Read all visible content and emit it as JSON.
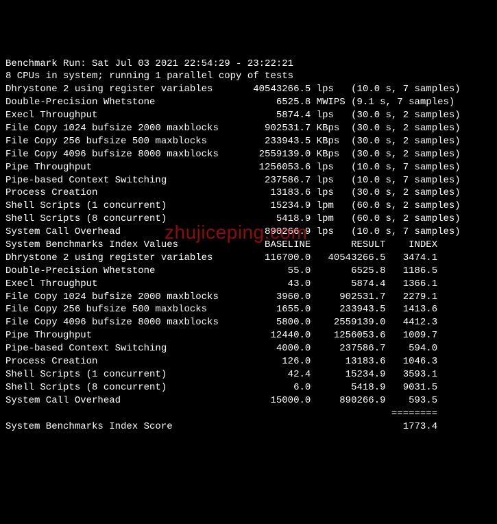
{
  "header": {
    "run_line": "Benchmark Run: Sat Jul 03 2021 22:54:29 - 23:22:21",
    "sys_line": "8 CPUs in system; running 1 parallel copy of tests"
  },
  "tests": [
    {
      "name": "Dhrystone 2 using register variables",
      "value": "40543266.5",
      "unit": "lps",
      "timing": "(10.0 s, 7 samples)"
    },
    {
      "name": "Double-Precision Whetstone",
      "value": "6525.8",
      "unit": "MWIPS",
      "timing": "(9.1 s, 7 samples)"
    },
    {
      "name": "Execl Throughput",
      "value": "5874.4",
      "unit": "lps",
      "timing": "(30.0 s, 2 samples)"
    },
    {
      "name": "File Copy 1024 bufsize 2000 maxblocks",
      "value": "902531.7",
      "unit": "KBps",
      "timing": "(30.0 s, 2 samples)"
    },
    {
      "name": "File Copy 256 bufsize 500 maxblocks",
      "value": "233943.5",
      "unit": "KBps",
      "timing": "(30.0 s, 2 samples)"
    },
    {
      "name": "File Copy 4096 bufsize 8000 maxblocks",
      "value": "2559139.0",
      "unit": "KBps",
      "timing": "(30.0 s, 2 samples)"
    },
    {
      "name": "Pipe Throughput",
      "value": "1256053.6",
      "unit": "lps",
      "timing": "(10.0 s, 7 samples)"
    },
    {
      "name": "Pipe-based Context Switching",
      "value": "237586.7",
      "unit": "lps",
      "timing": "(10.0 s, 7 samples)"
    },
    {
      "name": "Process Creation",
      "value": "13183.6",
      "unit": "lps",
      "timing": "(30.0 s, 2 samples)"
    },
    {
      "name": "Shell Scripts (1 concurrent)",
      "value": "15234.9",
      "unit": "lpm",
      "timing": "(60.0 s, 2 samples)"
    },
    {
      "name": "Shell Scripts (8 concurrent)",
      "value": "5418.9",
      "unit": "lpm",
      "timing": "(60.0 s, 2 samples)"
    },
    {
      "name": "System Call Overhead",
      "value": "890266.9",
      "unit": "lps",
      "timing": "(10.0 s, 7 samples)"
    }
  ],
  "index_header": {
    "title": "System Benchmarks Index Values",
    "col_baseline": "BASELINE",
    "col_result": "RESULT",
    "col_index": "INDEX"
  },
  "index_rows": [
    {
      "name": "Dhrystone 2 using register variables",
      "baseline": "116700.0",
      "result": "40543266.5",
      "index": "3474.1"
    },
    {
      "name": "Double-Precision Whetstone",
      "baseline": "55.0",
      "result": "6525.8",
      "index": "1186.5"
    },
    {
      "name": "Execl Throughput",
      "baseline": "43.0",
      "result": "5874.4",
      "index": "1366.1"
    },
    {
      "name": "File Copy 1024 bufsize 2000 maxblocks",
      "baseline": "3960.0",
      "result": "902531.7",
      "index": "2279.1"
    },
    {
      "name": "File Copy 256 bufsize 500 maxblocks",
      "baseline": "1655.0",
      "result": "233943.5",
      "index": "1413.6"
    },
    {
      "name": "File Copy 4096 bufsize 8000 maxblocks",
      "baseline": "5800.0",
      "result": "2559139.0",
      "index": "4412.3"
    },
    {
      "name": "Pipe Throughput",
      "baseline": "12440.0",
      "result": "1256053.6",
      "index": "1009.7"
    },
    {
      "name": "Pipe-based Context Switching",
      "baseline": "4000.0",
      "result": "237586.7",
      "index": "594.0"
    },
    {
      "name": "Process Creation",
      "baseline": "126.0",
      "result": "13183.6",
      "index": "1046.3"
    },
    {
      "name": "Shell Scripts (1 concurrent)",
      "baseline": "42.4",
      "result": "15234.9",
      "index": "3593.1"
    },
    {
      "name": "Shell Scripts (8 concurrent)",
      "baseline": "6.0",
      "result": "5418.9",
      "index": "9031.5"
    },
    {
      "name": "System Call Overhead",
      "baseline": "15000.0",
      "result": "890266.9",
      "index": "593.5"
    }
  ],
  "score": {
    "label": "System Benchmarks Index Score",
    "value": "1773.4",
    "divider": "========"
  },
  "watermark": "zhujiceping.com"
}
